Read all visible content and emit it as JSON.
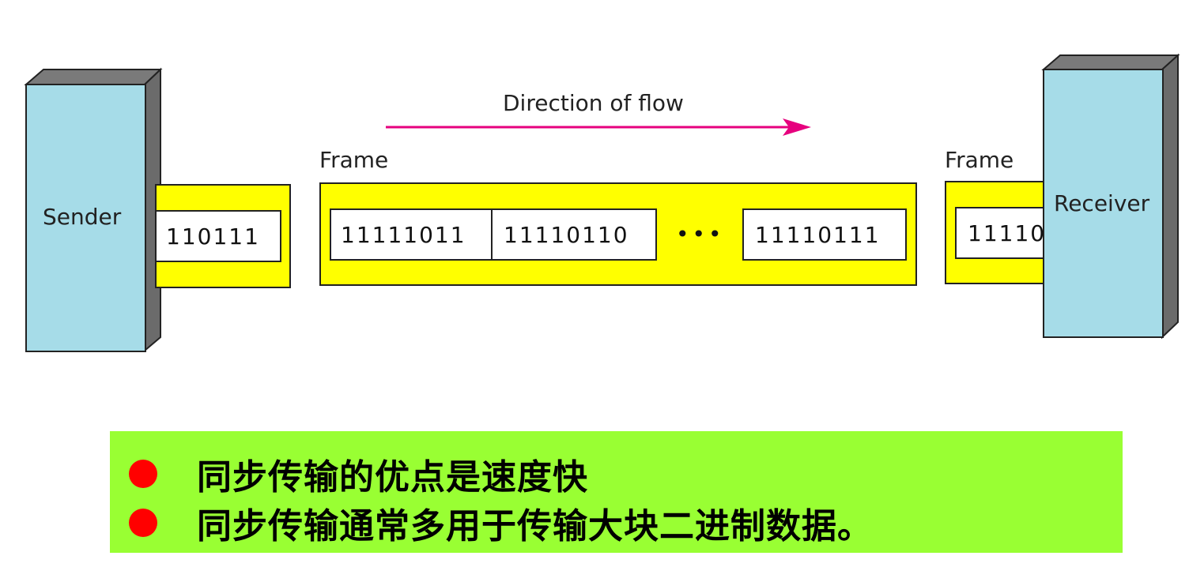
{
  "diagram": {
    "direction_label": "Direction of flow",
    "frame_label_middle": "Frame",
    "frame_label_right": "Frame",
    "sender_label": "Sender",
    "receiver_label": "Receiver",
    "sender_frame_bits": "110111",
    "middle_frame_bits": [
      "11111011",
      "11110110",
      "11110111"
    ],
    "ellipsis": "•••",
    "receiver_frame_bits": "11110",
    "colors": {
      "device": "#a6dce8",
      "device_side": "#6b6b6b",
      "frame": "#ffff00",
      "arrow": "#e6007e",
      "panel": "#99ff33",
      "bullet": "#ff0000"
    }
  },
  "notes": [
    "同步传输的优点是速度快",
    "同步传输通常多用于传输大块二进制数据。"
  ]
}
